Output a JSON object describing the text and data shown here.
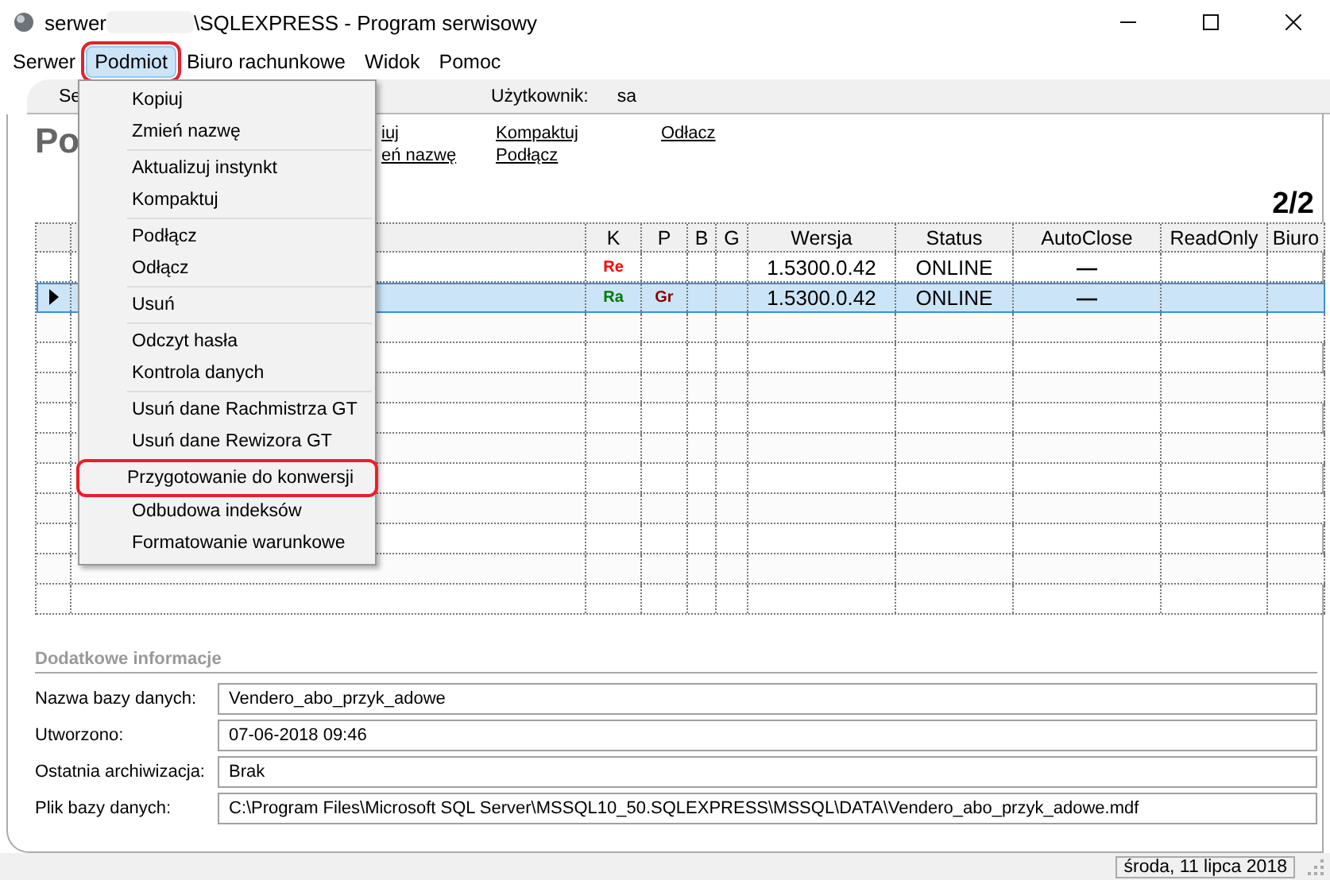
{
  "window": {
    "title_prefix": "serwer",
    "title_suffix": "\\SQLEXPRESS - Program serwisowy"
  },
  "menu_bar": [
    {
      "label": "Serwer",
      "selected": false,
      "marked": false
    },
    {
      "label": "Podmiot",
      "selected": true,
      "marked": true
    },
    {
      "label": "Biuro rachunkowe",
      "selected": false,
      "marked": false
    },
    {
      "label": "Widok",
      "selected": false,
      "marked": false
    },
    {
      "label": "Pomoc",
      "selected": false,
      "marked": false
    }
  ],
  "tab": {
    "label": "Se"
  },
  "user": {
    "label": "Użytkownik:",
    "value": "sa"
  },
  "heading": "Po",
  "links": [
    [
      "iuj",
      "eń nazwę"
    ],
    [
      "Kompaktuj",
      "Podłącz"
    ],
    [
      "Odłacz"
    ]
  ],
  "count": "2/2",
  "table": {
    "columns": [
      "K",
      "P",
      "B",
      "G",
      "Wersja",
      "Status",
      "AutoClose",
      "ReadOnly",
      "Biuro"
    ],
    "rows": [
      {
        "selected": false,
        "k": {
          "text": "Re",
          "color": "#ff0000"
        },
        "p": null,
        "version": "1.5300.0.42",
        "status": "ONLINE",
        "autoclose": "—"
      },
      {
        "selected": true,
        "k": {
          "text": "Ra",
          "color": "#007a00"
        },
        "p": {
          "text": "Gr",
          "color": "#8b0000"
        },
        "version": "1.5300.0.42",
        "status": "ONLINE",
        "autoclose": "—"
      }
    ]
  },
  "dropdown": [
    [
      {
        "label": "Kopiuj",
        "marked": false
      },
      {
        "label": "Zmień nazwę",
        "marked": false
      }
    ],
    [
      {
        "label": "Aktualizuj instynkt",
        "marked": false
      },
      {
        "label": "Kompaktuj",
        "marked": false
      }
    ],
    [
      {
        "label": "Podłącz",
        "marked": false
      },
      {
        "label": "Odłącz",
        "marked": false
      }
    ],
    [
      {
        "label": "Usuń",
        "marked": false
      }
    ],
    [
      {
        "label": "Odczyt hasła",
        "marked": false
      },
      {
        "label": "Kontrola danych",
        "marked": false
      }
    ],
    [
      {
        "label": "Usuń dane Rachmistrza GT",
        "marked": false
      },
      {
        "label": "Usuń dane Rewizora GT",
        "marked": false
      }
    ],
    [
      {
        "label": "Przygotowanie do konwersji",
        "marked": true
      },
      {
        "label": "Odbudowa indeksów",
        "marked": false
      },
      {
        "label": "Formatowanie warunkowe",
        "marked": false
      }
    ]
  ],
  "details": {
    "title": "Dodatkowe informacje",
    "fields": [
      {
        "label": "Nazwa bazy danych:",
        "value": "Vendero_abo_przyk_adowe"
      },
      {
        "label": "Utworzono:",
        "value": "07-06-2018 09:46"
      },
      {
        "label": "Ostatnia archiwizacja:",
        "value": "Brak"
      },
      {
        "label": "Plik bazy danych:",
        "value": "C:\\Program Files\\Microsoft SQL Server\\MSSQL10_50.SQLEXPRESS\\MSSQL\\DATA\\Vendero_abo_przyk_adowe.mdf"
      }
    ]
  },
  "status_bar": {
    "date": "środa, 11 lipca 2018"
  }
}
